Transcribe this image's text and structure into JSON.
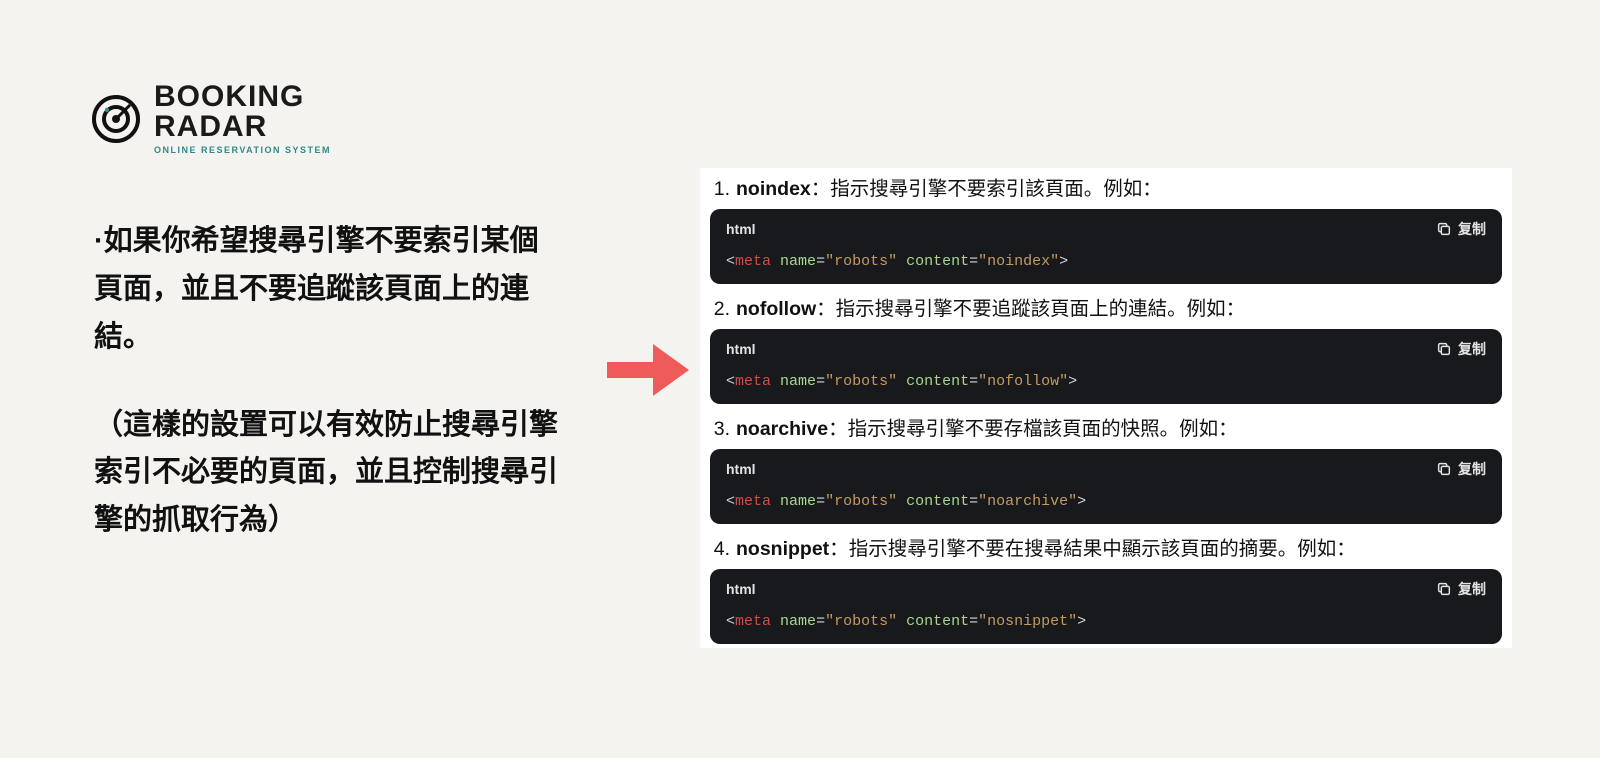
{
  "logo": {
    "name": "BOOKING\nRADAR",
    "tagline": "ONLINE RESERVATION SYSTEM"
  },
  "left": {
    "p1": "·如果你希望搜尋引擎不要索引某個頁面，並且不要追蹤該頁面上的連結。",
    "p2": "（這樣的設置可以有效防止搜尋引擎索引不必要的頁面，並且控制搜尋引擎的抓取行為）"
  },
  "items": [
    {
      "num": "1.",
      "key": "noindex",
      "sep": "：",
      "desc": "指示搜尋引擎不要索引該頁面。例如：",
      "lang": "html",
      "copy": "复制",
      "code_val": "noindex"
    },
    {
      "num": "2.",
      "key": "nofollow",
      "sep": "：",
      "desc": "指示搜尋引擎不要追蹤該頁面上的連結。例如：",
      "lang": "html",
      "copy": "复制",
      "code_val": "nofollow"
    },
    {
      "num": "3.",
      "key": "noarchive",
      "sep": "：",
      "desc": "指示搜尋引擎不要存檔該頁面的快照。例如：",
      "lang": "html",
      "copy": "复制",
      "code_val": "noarchive"
    },
    {
      "num": "4.",
      "key": "nosnippet",
      "sep": "：",
      "desc": "指示搜尋引擎不要在搜尋結果中顯示該頁面的摘要。例如：",
      "lang": "html",
      "copy": "复制",
      "code_val": "nosnippet"
    }
  ],
  "code_template": {
    "prefix": "<meta ",
    "attr_name": "name",
    "eq": "=",
    "q": "\"",
    "name_val": "robots",
    "attr_content": "content",
    "suffix": ">"
  }
}
